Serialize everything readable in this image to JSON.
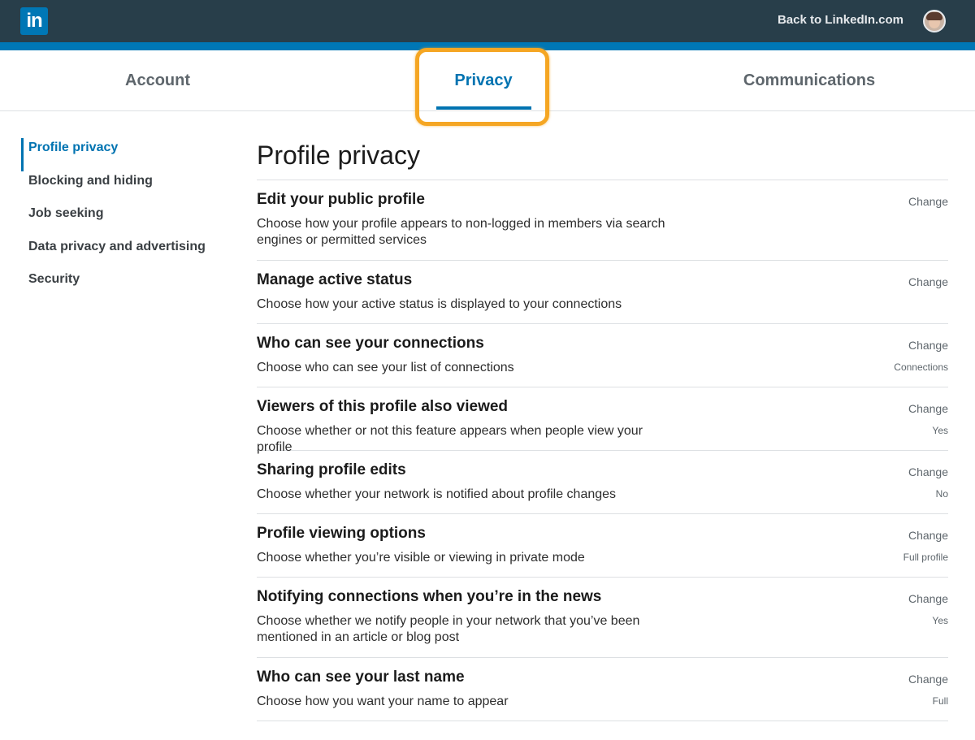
{
  "header": {
    "logo_text": "in",
    "back_link": "Back to LinkedIn.com"
  },
  "tabs": [
    {
      "label": "Account"
    },
    {
      "label": "Privacy",
      "active": true
    },
    {
      "label": "Communications"
    }
  ],
  "sidebar": {
    "items": [
      {
        "label": "Profile privacy",
        "active": true
      },
      {
        "label": "Blocking and hiding"
      },
      {
        "label": "Job seeking"
      },
      {
        "label": "Data privacy and advertising"
      },
      {
        "label": "Security"
      }
    ]
  },
  "main": {
    "title": "Profile privacy",
    "rows": [
      {
        "title": "Edit your public profile",
        "desc": "Choose how your profile appears to non-logged in members via search engines or permitted services",
        "action": "Change",
        "value": ""
      },
      {
        "title": "Manage active status",
        "desc": "Choose how your active status is displayed to your connections",
        "action": "Change",
        "value": ""
      },
      {
        "title": "Who can see your connections",
        "desc": "Choose who can see your list of connections",
        "action": "Change",
        "value": "Connections"
      },
      {
        "title": "Viewers of this profile also viewed",
        "desc": "Choose whether or not this feature appears when people view your profile",
        "action": "Change",
        "value": "Yes"
      },
      {
        "title": "Sharing profile edits",
        "desc": "Choose whether your network is notified about profile changes",
        "action": "Change",
        "value": "No"
      },
      {
        "title": "Profile viewing options",
        "desc": "Choose whether you’re visible or viewing in private mode",
        "action": "Change",
        "value": "Full profile"
      },
      {
        "title": "Notifying connections when you’re in the news",
        "desc": "Choose whether we notify people in your network that you’ve been mentioned in an article or blog post",
        "action": "Change",
        "value": "Yes"
      },
      {
        "title": "Who can see your last name",
        "desc": "Choose how you want your name to appear",
        "action": "Change",
        "value": "Full"
      }
    ]
  },
  "colors": {
    "topbar": "#283e4a",
    "brand_blue": "#0077b5",
    "active_blue": "#0073b1",
    "highlight_orange": "#f5a623"
  },
  "icons": {
    "logo": "linkedin-logo",
    "avatar": "user-avatar"
  }
}
